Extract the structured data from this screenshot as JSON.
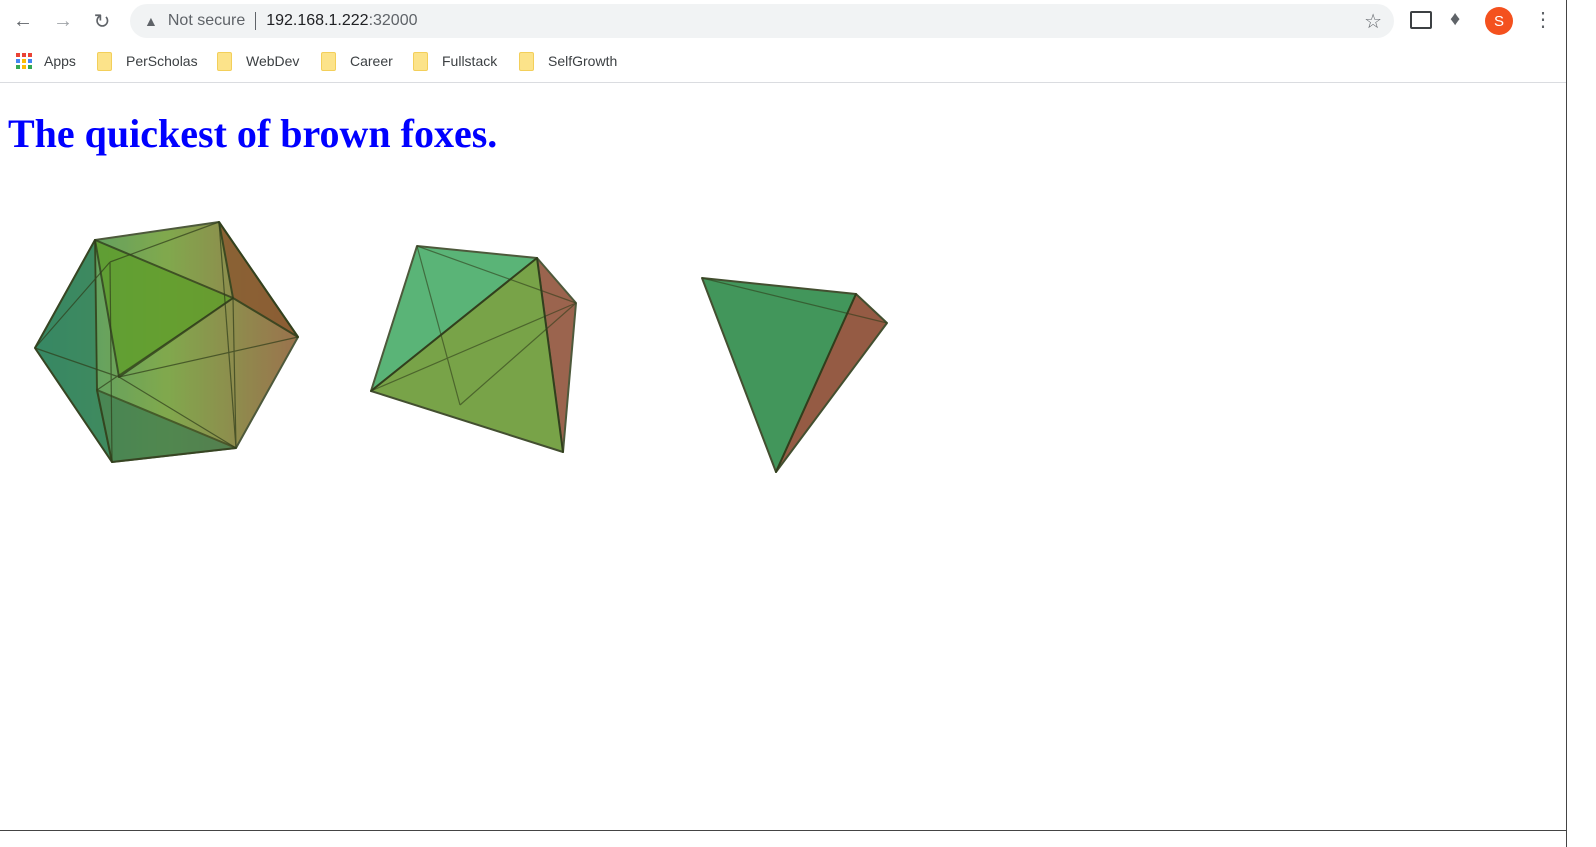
{
  "browser": {
    "security_label": "Not secure",
    "url_host": "192.168.1.222",
    "url_port": ":32000",
    "profile_initial": "S",
    "bookmarks": [
      {
        "label": "Apps"
      },
      {
        "label": "PerScholas"
      },
      {
        "label": "WebDev"
      },
      {
        "label": "Career"
      },
      {
        "label": "Fullstack"
      },
      {
        "label": "SelfGrowth"
      }
    ]
  },
  "page": {
    "heading": "The quickest of brown foxes.",
    "heading_color": "#0000ff"
  }
}
